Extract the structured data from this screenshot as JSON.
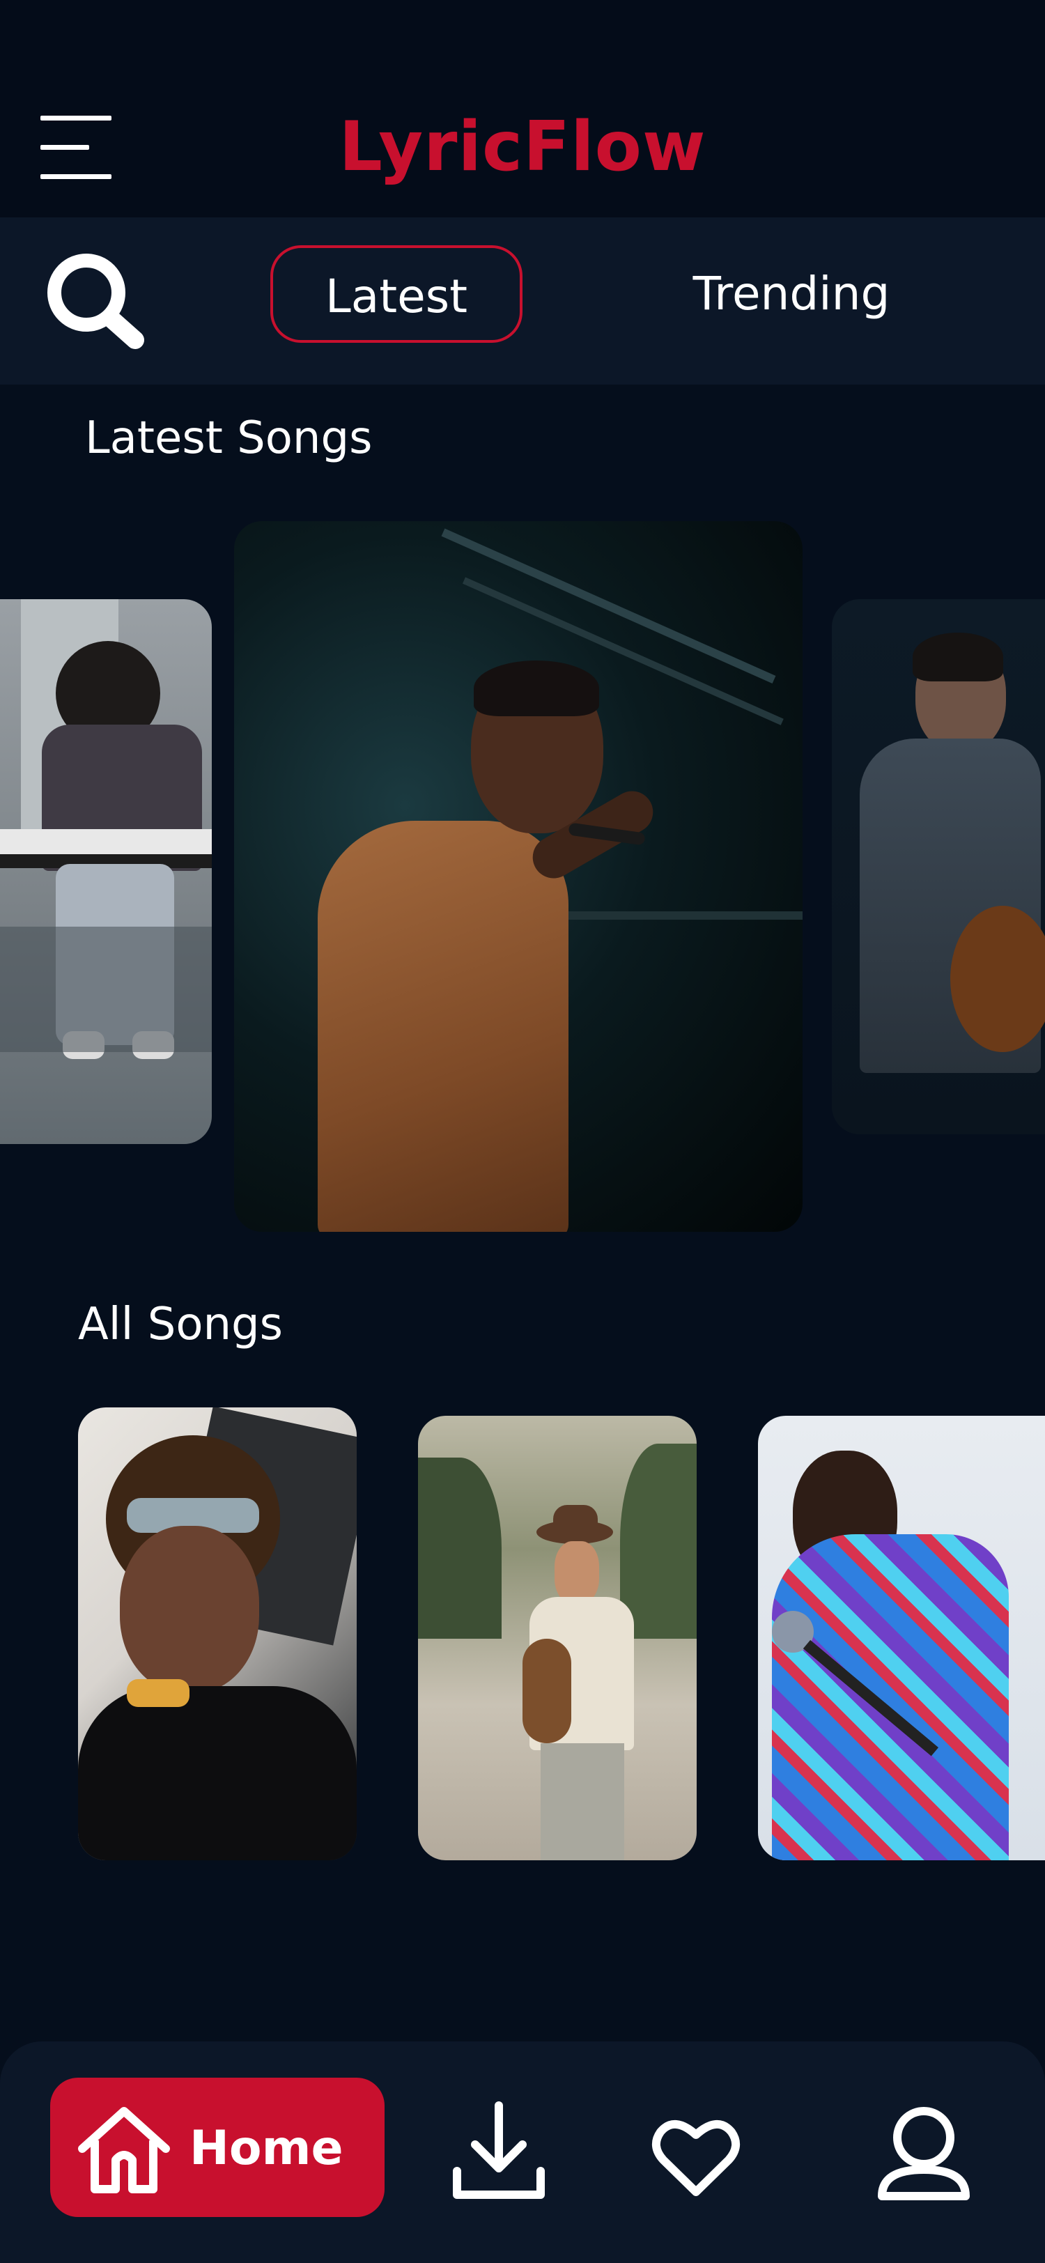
{
  "app": {
    "title": "LyricFlow"
  },
  "tabs": [
    {
      "label": "Latest",
      "active": true
    },
    {
      "label": "Trending",
      "active": false
    }
  ],
  "sections": {
    "latest_title": "Latest Songs",
    "all_title": "All Songs"
  },
  "nav": {
    "home_label": "Home",
    "items": [
      "home-icon",
      "download-icon",
      "heart-icon",
      "profile-icon"
    ]
  },
  "colors": {
    "accent": "#c8102e",
    "background": "#050e1c",
    "panel": "#0c1728"
  }
}
